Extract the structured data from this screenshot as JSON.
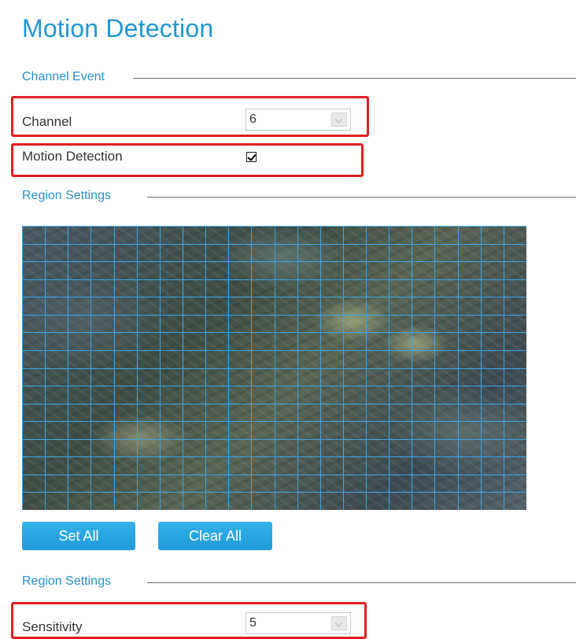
{
  "page_title": "Motion Detection",
  "sections": {
    "channel_event": "Channel Event",
    "region_settings": "Region Settings",
    "region_settings_2": "Region Settings"
  },
  "channel": {
    "label": "Channel",
    "value": "6"
  },
  "motion_detection": {
    "label": "Motion Detection",
    "checked": true
  },
  "buttons": {
    "set_all": "Set All",
    "clear_all": "Clear All"
  },
  "sensitivity": {
    "label": "Sensitivity",
    "value": "5"
  },
  "colors": {
    "accent": "#1f97d2",
    "button": "#27a6e2",
    "highlight": "#e02020",
    "grid_line": "#3aa6ea"
  },
  "grid": {
    "columns": 22,
    "rows": 16
  }
}
